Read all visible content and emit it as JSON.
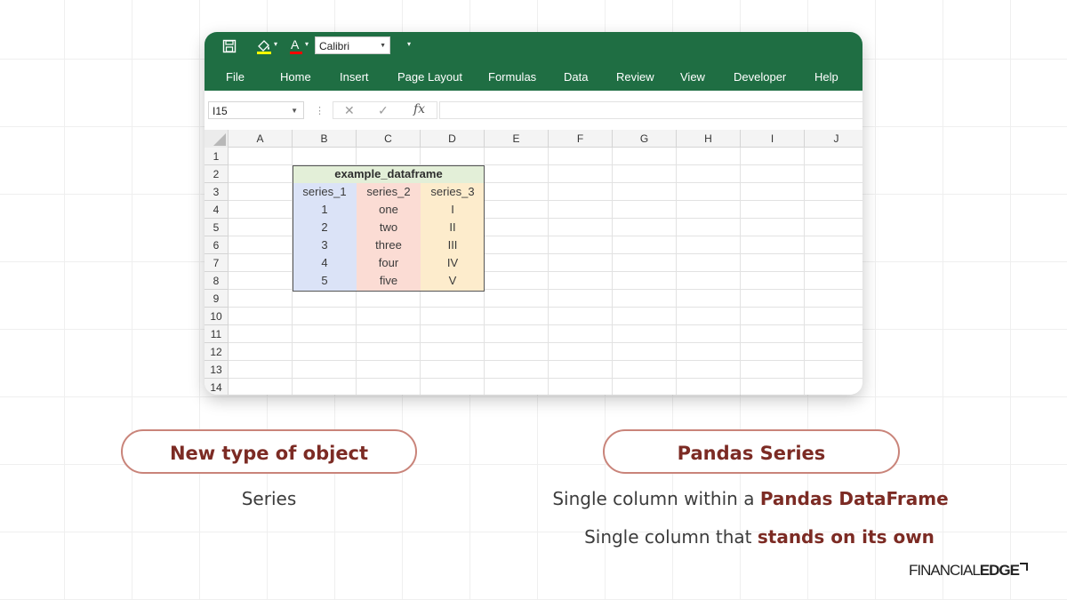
{
  "excel": {
    "quick_access": {
      "save_icon": "save-icon",
      "fill_icon": "fill-color-icon",
      "font_color_icon": "font-color-icon",
      "font_name": "Calibri"
    },
    "tabs": [
      "File",
      "Home",
      "Insert",
      "Page Layout",
      "Formulas",
      "Data",
      "Review",
      "View",
      "Developer",
      "Help"
    ],
    "name_box": "I15",
    "formula_icons": {
      "cancel": "✕",
      "enter": "✓",
      "function": "fx"
    },
    "formula_value": "",
    "columns": [
      "A",
      "B",
      "C",
      "D",
      "E",
      "F",
      "G",
      "H",
      "I",
      "J"
    ],
    "rows": [
      "1",
      "2",
      "3",
      "4",
      "5",
      "6",
      "7",
      "8",
      "9",
      "10",
      "11",
      "12",
      "13",
      "14"
    ],
    "dataframe": {
      "title": "example_dataframe",
      "headers": [
        "series_1",
        "series_2",
        "series_3"
      ],
      "series_1": [
        "1",
        "2",
        "3",
        "4",
        "5"
      ],
      "series_2": [
        "one",
        "two",
        "three",
        "four",
        "five"
      ],
      "series_3": [
        "I",
        "II",
        "III",
        "IV",
        "V"
      ],
      "colors": {
        "title": "#e3efd8",
        "series_1": "#dbe3f7",
        "series_2": "#fbdcd4",
        "series_3": "#fdeccc"
      }
    }
  },
  "left_panel": {
    "pill": "New type of object",
    "caption": "Series"
  },
  "right_panel": {
    "pill": "Pandas Series",
    "line1_text": "Single column within a ",
    "line1_bold": "Pandas DataFrame",
    "line2_text": "Single column that ",
    "line2_bold": "stands on its own"
  },
  "logo": {
    "part1": "FINANCIAL",
    "part2": "EDGE"
  },
  "colors": {
    "ribbon": "#1f6e43",
    "accent": "#7c2b24",
    "pill_border": "#c9847a"
  }
}
